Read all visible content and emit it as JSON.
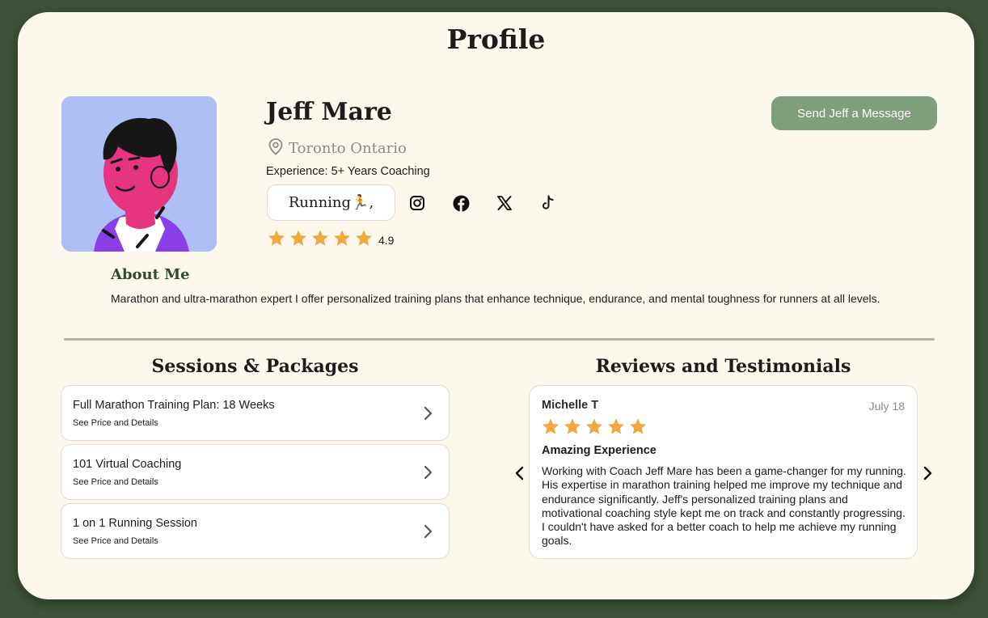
{
  "page": {
    "title": "Profile"
  },
  "profile": {
    "name": "Jeff Mare",
    "location": "Toronto Ontario",
    "experience": "Experience: 5+ Years Coaching",
    "sport_tag": "Running🏃,",
    "rating": "4.9",
    "rating_stars": 5,
    "message_button": "Send Jeff a Message",
    "social": [
      "instagram-icon",
      "facebook-icon",
      "x-icon",
      "tiktok-icon"
    ]
  },
  "about": {
    "heading": "About Me",
    "text": "Marathon and ultra-marathon expert I offer personalized training plans that enhance technique, endurance, and mental toughness for runners at all levels."
  },
  "packages": {
    "heading": "Sessions & Packages",
    "items": [
      {
        "title": "Full Marathon Training Plan: 18 Weeks",
        "subtitle": "See Price and Details"
      },
      {
        "title": "101 Virtual Coaching",
        "subtitle": "See Price and Details"
      },
      {
        "title": "1 on 1 Running Session",
        "subtitle": "See Price and Details"
      }
    ]
  },
  "reviews": {
    "heading": "Reviews and Testimonials",
    "current": {
      "reviewer": "Michelle T",
      "date": "July 18",
      "stars": 5,
      "title": "Amazing Experience",
      "text": "Working with Coach Jeff Mare has been a game-changer for my running. His expertise in marathon training helped me improve my technique and endurance significantly. Jeff's personalized training plans and motivational coaching style kept me on track and constantly progressing. I couldn't have asked for a better coach to help me achieve my running goals."
    }
  },
  "colors": {
    "background": "#3d5236",
    "card": "#fdf8ee",
    "accent_button": "#7f9e7a",
    "star": "#f0a840",
    "about_heading": "#2f4a2f"
  }
}
